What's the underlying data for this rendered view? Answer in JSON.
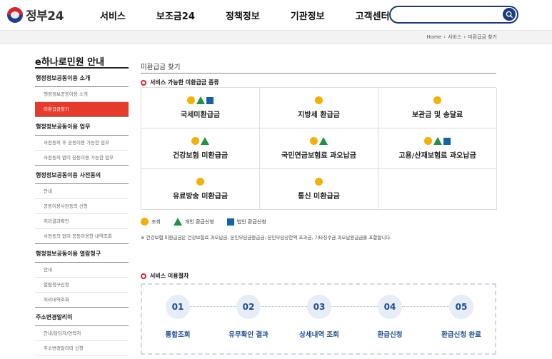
{
  "header": {
    "logo_text": "정부24",
    "nav": [
      "서비스",
      "보조금24",
      "정책정보",
      "기관정보",
      "고객센터"
    ],
    "search_placeholder": ""
  },
  "breadcrumb": [
    "Home",
    "서비스",
    "미환급금 찾기"
  ],
  "sidebar": {
    "title": "e하나로민원 안내",
    "groups": [
      {
        "title": "행정정보공동이용 소개",
        "items": [
          {
            "label": "행정정보공동이용 소개",
            "active": false
          },
          {
            "label": "미환급금찾기",
            "active": true
          }
        ]
      },
      {
        "title": "행정정보공동이용 업무",
        "items": [
          {
            "label": "사전동의 후 공동이용 가능한 업무",
            "active": false
          },
          {
            "label": "사전동의 없이 공동이용 가능한 업무",
            "active": false
          }
        ]
      },
      {
        "title": "행정정보공동이용 사전동의",
        "items": [
          {
            "label": "안내",
            "active": false
          },
          {
            "label": "공동이용사전동의 신청",
            "active": false
          },
          {
            "label": "처리결과확인",
            "active": false
          },
          {
            "label": "사전동의 없이 공동이용한 내역조회",
            "active": false
          }
        ]
      },
      {
        "title": "행정정보공동이용 열람청구",
        "items": [
          {
            "label": "안내",
            "active": false
          },
          {
            "label": "열람청구신청",
            "active": false
          },
          {
            "label": "처리내역조회",
            "active": false
          }
        ]
      },
      {
        "title": "주소변경알리미",
        "items": [
          {
            "label": "안내/담당자/연락처",
            "active": false
          },
          {
            "label": "주소변경알리미 신청",
            "active": false
          }
        ]
      }
    ]
  },
  "main": {
    "title": "미환급금 찾기",
    "section_kinds": "서비스 가능한 미환급금 종류",
    "cells": [
      {
        "label": "국세미환급금",
        "icons": [
          "circle",
          "triangle",
          "square"
        ]
      },
      {
        "label": "지방세 환급금",
        "icons": [
          "circle"
        ]
      },
      {
        "label": "보관금 및 송달료",
        "icons": [
          "circle"
        ]
      },
      {
        "label": "건강보험 미환급금",
        "icons": [
          "circle",
          "triangle"
        ]
      },
      {
        "label": "국민연금보험료 과오납금",
        "icons": [
          "circle",
          "triangle"
        ]
      },
      {
        "label": "고용/산재보험료 과오납금",
        "icons": [
          "circle",
          "triangle",
          "square"
        ]
      },
      {
        "label": "유료방송 미환급금",
        "icons": [
          "circle"
        ]
      },
      {
        "label": "통신 미환급금",
        "icons": [
          "circle"
        ]
      },
      {
        "label": "",
        "icons": []
      }
    ],
    "legend": [
      {
        "icon": "circle",
        "label": "조회"
      },
      {
        "icon": "triangle",
        "label": "개인 환급신청"
      },
      {
        "icon": "square",
        "label": "법인 환급신청"
      }
    ],
    "note": "※ 건강보험 미환급금은 건강보험료 과오납금, 본인부담금환급금, 본인부담상한액 초과금, 기타징수금 과오납환급금을 포함합니다.",
    "section_process": "서비스 이용절차",
    "steps": [
      {
        "num": "01",
        "label": "통합조회"
      },
      {
        "num": "02",
        "label": "유무확인 결과"
      },
      {
        "num": "03",
        "label": "상세내역 조회"
      },
      {
        "num": "04",
        "label": "환급신청"
      },
      {
        "num": "05",
        "label": "환급신청 완료"
      }
    ]
  },
  "colors": {
    "circle": "#f2b103",
    "triangle": "#1c9346",
    "square": "#1463a8",
    "accent_red": "#e63a2d",
    "navy": "#1d3a7d"
  }
}
